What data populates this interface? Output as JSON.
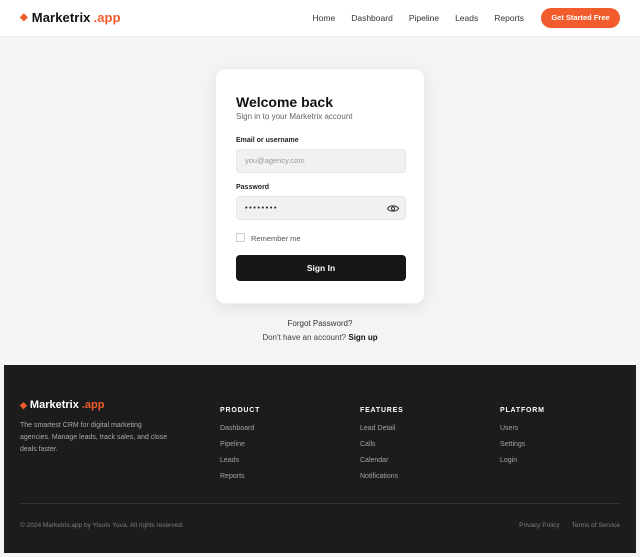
{
  "header": {
    "brand": "Marketrix",
    "brand_accent": ".app",
    "nav": [
      "Home",
      "Dashboard",
      "Pipeline",
      "Leads",
      "Reports"
    ],
    "cta": "Get Started Free"
  },
  "login": {
    "title": "Welcome back",
    "subtitle": "Sign in to your Marketrix account",
    "email_label": "Email or username",
    "email_placeholder": "you@agency.com",
    "password_label": "Password",
    "password_value": "••••••••",
    "remember": "Remember me",
    "submit": "Sign In",
    "forgot": "Forgot Password?",
    "no_account": "Don't have an account?",
    "signup": "Sign up"
  },
  "footer": {
    "brand": "Marketrix",
    "brand_accent": ".app",
    "description": "The smartest CRM for digital marketing agencies. Manage leads, track sales, and close deals faster.",
    "columns": [
      {
        "head": "PRODUCT",
        "items": [
          "Dashboard",
          "Pipeline",
          "Leads",
          "Reports"
        ]
      },
      {
        "head": "FEATURES",
        "items": [
          "Lead Detail",
          "Calls",
          "Calendar",
          "Notifications"
        ]
      },
      {
        "head": "PLATFORM",
        "items": [
          "Users",
          "Settings",
          "Login"
        ]
      }
    ],
    "copyright": "© 2024 Marketrix.app by Youris Yuva. All rights reserved.",
    "links": [
      "Privacy Policy",
      "Terms of Service"
    ]
  },
  "colors": {
    "accent": "#f25c2c",
    "dark": "#1c1c1c"
  },
  "icons": {
    "brand_mark": "diamond-icon",
    "password_toggle": "eye-icon"
  }
}
